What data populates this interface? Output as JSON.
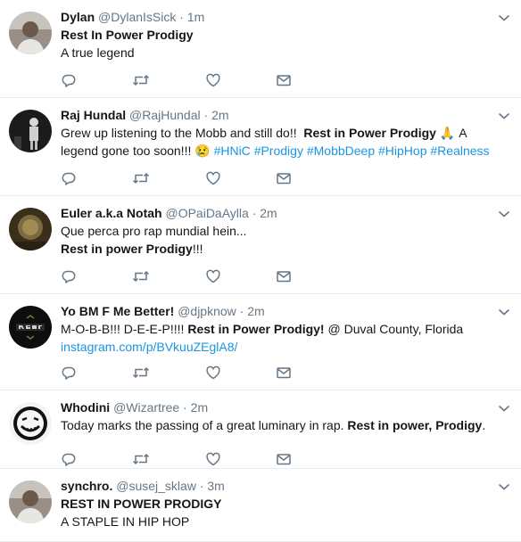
{
  "tweets": [
    {
      "name": "Dylan",
      "handle": "@DylanIsSick",
      "time": "1m",
      "lines": [
        [
          {
            "t": "Rest In Power Prodigy",
            "b": true
          }
        ],
        [
          {
            "t": "A true legend"
          }
        ]
      ],
      "avatar": "avatar-person-portrait"
    },
    {
      "name": "Raj Hundal",
      "handle": "@RajHundal",
      "time": "2m",
      "lines": [
        [
          {
            "t": "Grew up listening to the Mobb and still do!!  "
          },
          {
            "t": "Rest in Power Prodigy",
            "b": true
          },
          {
            "t": " 🙏 ",
            "emoji": true
          },
          {
            "t": "A"
          }
        ],
        [
          {
            "t": "legend gone too soon!!! "
          },
          {
            "t": "😢",
            "emoji": true
          },
          {
            "t": " "
          },
          {
            "t": "#HNiC",
            "c": "tag"
          },
          {
            "t": " "
          },
          {
            "t": "#Prodigy",
            "c": "tag"
          },
          {
            "t": " "
          },
          {
            "t": "#MobbDeep",
            "c": "tag"
          },
          {
            "t": " "
          },
          {
            "t": "#HipHop",
            "c": "tag"
          },
          {
            "t": " "
          },
          {
            "t": "#Realness",
            "c": "tag"
          }
        ]
      ],
      "avatar": "avatar-stage-performer"
    },
    {
      "name": "Euler a.k.a Notah",
      "handle": "@OPaiDaAylla",
      "time": "2m",
      "lines": [
        [
          {
            "t": "Que perca pro rap mundial hein..."
          }
        ],
        [
          {
            "t": "Rest in power Prodigy",
            "b": true
          },
          {
            "t": "!!!"
          }
        ]
      ],
      "avatar": "avatar-portrait"
    },
    {
      "name": "Yo BM F Me Better!",
      "handle": "@djpknow",
      "time": "2m",
      "lines": [
        [
          {
            "t": "M-O-B-B!!! D-E-E-P!!!! "
          },
          {
            "t": "Rest in Power Prodigy!",
            "b": true
          },
          {
            "t": " @ Duval County, Florida"
          }
        ],
        [
          {
            "t": "instagram.com/p/BVkuuZEglA8/",
            "c": "link"
          }
        ]
      ],
      "avatar": "avatar-logo"
    },
    {
      "name": "Whodini",
      "handle": "@Wizartree",
      "time": "2m",
      "lines": [
        [
          {
            "t": "Today marks the passing of a great luminary in rap. "
          },
          {
            "t": "Rest in power, Prodigy",
            "b": true
          },
          {
            "t": "."
          }
        ]
      ],
      "avatar": "avatar-smiley-face"
    },
    {
      "name": "synchro.",
      "handle": "@susej_sklaw",
      "time": "3m",
      "lines": [
        [
          {
            "t": "REST IN POWER PRODIGY",
            "b": true
          }
        ],
        [
          {
            "t": "A STAPLE IN HIP HOP"
          }
        ]
      ],
      "avatar": "avatar-person-portrait"
    }
  ],
  "icons": {
    "reply": "reply-icon",
    "retweet": "retweet-icon",
    "like": "heart-icon",
    "message": "envelope-icon",
    "caret": "chevron-down-icon"
  },
  "colors": {
    "name": "#14171a",
    "secondary": "#657786",
    "link": "#1b95e0",
    "divider": "#e6ecf0",
    "icon": "#657786"
  }
}
